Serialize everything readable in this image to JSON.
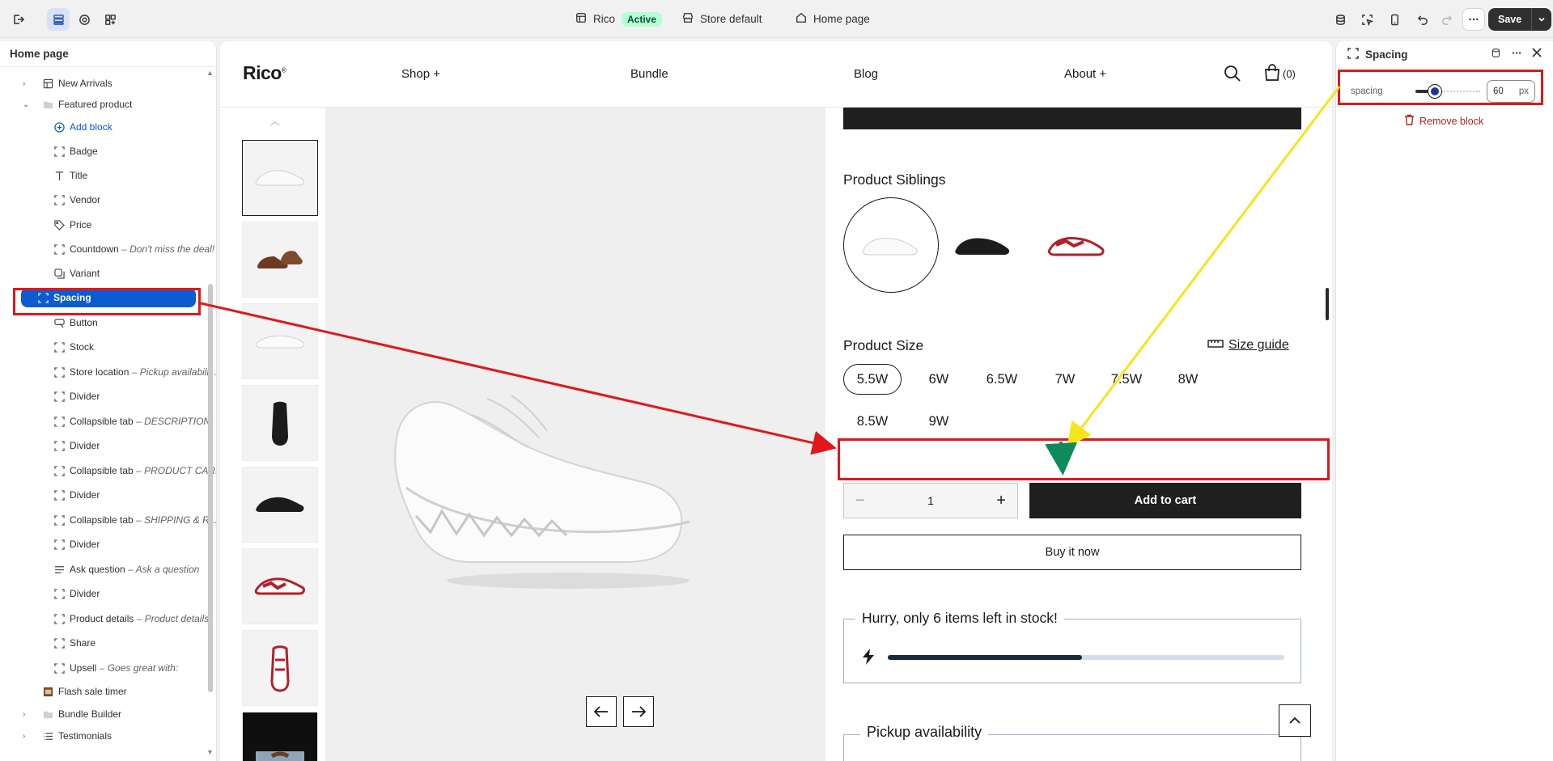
{
  "topbar": {
    "store_name": "Rico",
    "store_status": "Active",
    "market": "Store default",
    "page": "Home page",
    "save_label": "Save"
  },
  "sidebar": {
    "title": "Home page",
    "items": [
      {
        "label": "New Arrivals",
        "sub": ""
      },
      {
        "label": "Featured product",
        "sub": ""
      },
      {
        "label": "Add block",
        "sub": ""
      },
      {
        "label": "Badge",
        "sub": ""
      },
      {
        "label": "Title",
        "sub": ""
      },
      {
        "label": "Vendor",
        "sub": ""
      },
      {
        "label": "Price",
        "sub": ""
      },
      {
        "label": "Countdown",
        "sub": "– Don't miss the deal!"
      },
      {
        "label": "Variant",
        "sub": ""
      },
      {
        "label": "Spacing",
        "sub": ""
      },
      {
        "label": "Button",
        "sub": ""
      },
      {
        "label": "Stock",
        "sub": ""
      },
      {
        "label": "Store location",
        "sub": "– Pickup availabili..."
      },
      {
        "label": "Divider",
        "sub": ""
      },
      {
        "label": "Collapsible tab",
        "sub": "– DESCRIPTION"
      },
      {
        "label": "Divider",
        "sub": ""
      },
      {
        "label": "Collapsible tab",
        "sub": "– PRODUCT CARE"
      },
      {
        "label": "Divider",
        "sub": ""
      },
      {
        "label": "Collapsible tab",
        "sub": "– SHIPPING & R..."
      },
      {
        "label": "Divider",
        "sub": ""
      },
      {
        "label": "Ask question",
        "sub": "– Ask a question"
      },
      {
        "label": "Divider",
        "sub": ""
      },
      {
        "label": "Product details",
        "sub": "– Product details"
      },
      {
        "label": "Share",
        "sub": ""
      },
      {
        "label": "Upsell",
        "sub": "– Goes great with:"
      },
      {
        "label": "Flash sale timer",
        "sub": ""
      },
      {
        "label": "Bundle Builder",
        "sub": ""
      },
      {
        "label": "Testimonials",
        "sub": ""
      }
    ]
  },
  "preview": {
    "logo": "Rico",
    "nav": [
      "Shop +",
      "Bundle",
      "Blog",
      "About +"
    ],
    "cart_count": "(0)",
    "siblings_title": "Product Siblings",
    "size_title": "Product Size",
    "size_guide": "Size guide",
    "sizes": [
      "5.5W",
      "6W",
      "6.5W",
      "7W",
      "7.5W",
      "8W",
      "8.5W",
      "9W"
    ],
    "selected_size": "5.5W",
    "quantity": "1",
    "add_to_cart": "Add to cart",
    "buy_now": "Buy it now",
    "stock_message": "Hurry, only 6 items left in stock!",
    "stock_fraction": 0.49,
    "pickup_title": "Pickup availability"
  },
  "settings": {
    "title": "Spacing",
    "field_label": "spacing",
    "value": "60",
    "unit": "px",
    "slider_fraction": 0.3,
    "remove_label": "Remove block"
  },
  "colors": {
    "accent": "#0b5bd3",
    "annotation_red": "#e0171b",
    "annotation_yellow": "#f5e61a",
    "annotation_green": "#0f8a5f"
  }
}
